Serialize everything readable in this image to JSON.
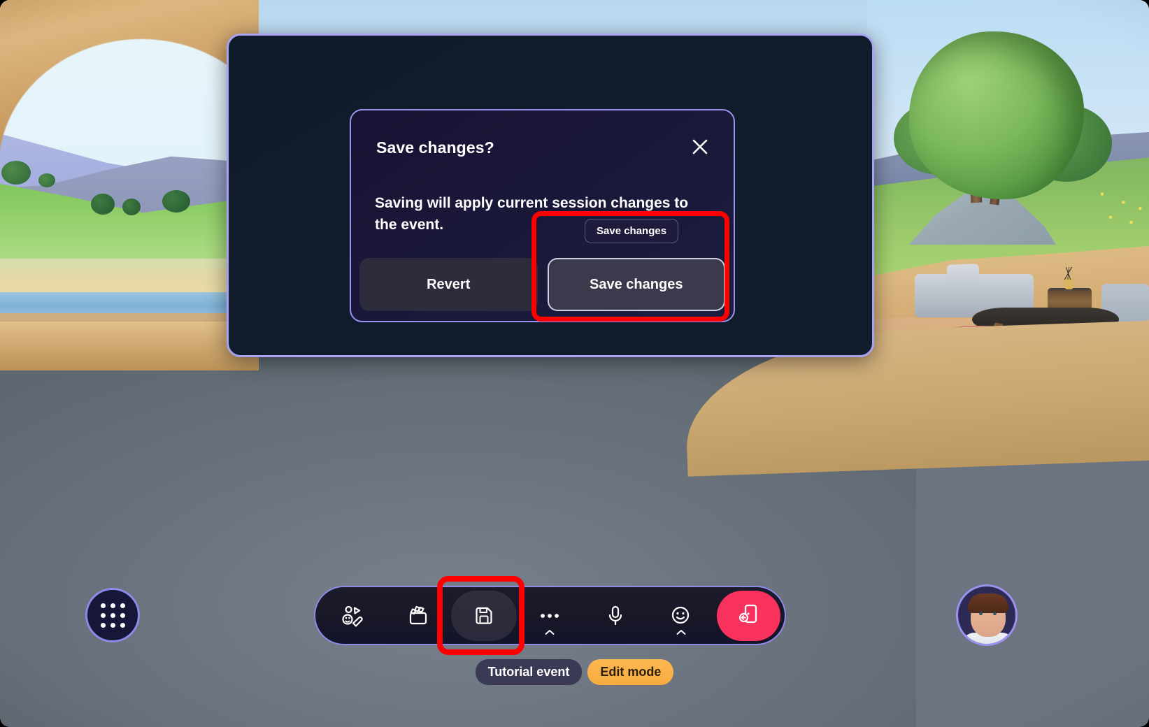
{
  "app": {
    "scene_name": "virtual-event-space"
  },
  "panel": {
    "name": "event-edit-panel"
  },
  "dialog": {
    "title": "Save changes?",
    "body": "Saving will apply current session changes to the event.",
    "close_icon": "close-icon",
    "buttons": [
      {
        "label": "Revert",
        "focused": false
      },
      {
        "label": "Save changes",
        "focused": true
      }
    ]
  },
  "tooltip": {
    "text": "Save changes"
  },
  "highlights": [
    {
      "name": "save-changes-dialog-highlight",
      "color": "#ff0000"
    },
    {
      "name": "save-toolbar-button-highlight",
      "color": "#ff0000"
    }
  ],
  "toolbar": {
    "items": [
      {
        "name": "stickers-button",
        "icon": "stickers-icon",
        "label": "Stickers",
        "active": false,
        "caret": false
      },
      {
        "name": "scenes-button",
        "icon": "clapperboard-icon",
        "label": "Scenes",
        "active": false,
        "caret": false
      },
      {
        "name": "save-button",
        "icon": "save-disk-icon",
        "label": "Save",
        "active": true,
        "caret": false
      },
      {
        "name": "more-button",
        "icon": "more-ellipsis-icon",
        "label": "More",
        "active": false,
        "caret": true
      },
      {
        "name": "microphone-button",
        "icon": "microphone-icon",
        "label": "Mic",
        "active": false,
        "caret": false
      },
      {
        "name": "reactions-button",
        "icon": "smiley-icon",
        "label": "React",
        "active": false,
        "caret": true
      }
    ],
    "leave": {
      "name": "leave-button",
      "icon": "leave-door-icon",
      "label": "Leave",
      "color": "#f8315d"
    }
  },
  "grid_button": {
    "name": "app-grid-button",
    "icon": "grid-dots-icon",
    "label": "Apps"
  },
  "avatar": {
    "name": "user-avatar",
    "label": "User avatar"
  },
  "status_pills": [
    {
      "name": "event-name-pill",
      "label": "Tutorial event",
      "bg": "#3b3a56",
      "fg": "#ffffff"
    },
    {
      "name": "edit-mode-pill",
      "label": "Edit mode",
      "bg": "#f9b04a",
      "fg": "#2a1f0a"
    }
  ],
  "colors": {
    "panel_border": "#a9a2f0",
    "dialog_border": "#9a92ef",
    "accent_red": "#f8315d",
    "highlight_red": "#ff0000",
    "edit_mode_orange": "#f9b04a"
  }
}
